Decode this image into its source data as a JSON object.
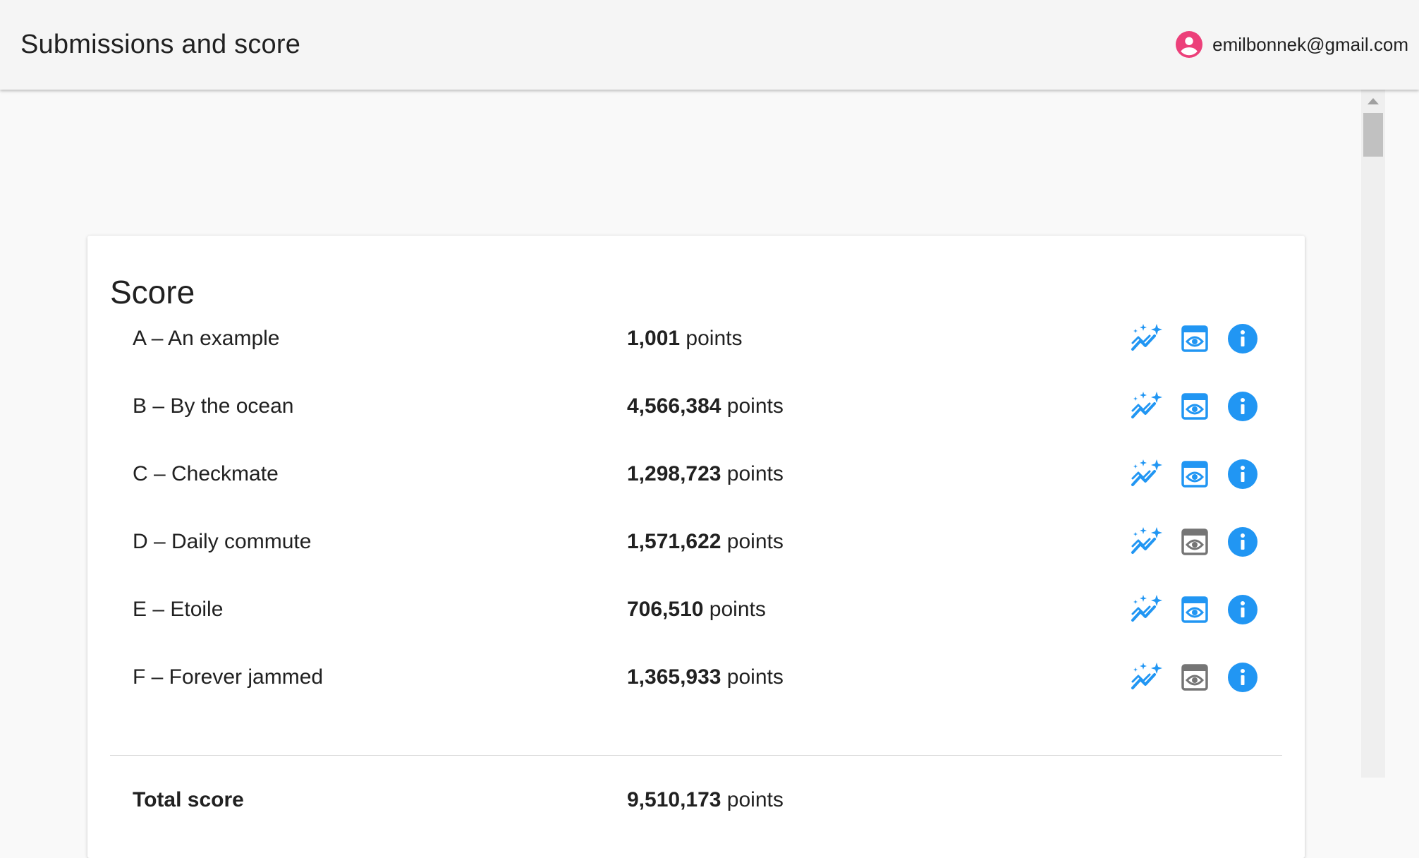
{
  "header": {
    "title": "Submissions and score",
    "user_email": "emilbonnek@gmail.com"
  },
  "card": {
    "title": "Score"
  },
  "rows": [
    {
      "name": "A – An example",
      "score": "1,001",
      "unit": " points",
      "preview_enabled": true
    },
    {
      "name": "B – By the ocean",
      "score": "4,566,384",
      "unit": " points",
      "preview_enabled": true
    },
    {
      "name": "C – Checkmate",
      "score": "1,298,723",
      "unit": " points",
      "preview_enabled": true
    },
    {
      "name": "D – Daily commute",
      "score": "1,571,622",
      "unit": " points",
      "preview_enabled": false
    },
    {
      "name": "E – Etoile",
      "score": "706,510",
      "unit": " points",
      "preview_enabled": true
    },
    {
      "name": "F – Forever jammed",
      "score": "1,365,933",
      "unit": " points",
      "preview_enabled": false
    }
  ],
  "total": {
    "label": "Total score",
    "score": "9,510,173",
    "unit": " points"
  },
  "icons": {
    "avatar": "account-circle-icon",
    "visualize": "auto-graph-icon",
    "preview": "preview-icon",
    "info": "info-icon"
  },
  "colors": {
    "accent": "#2196f3",
    "avatar": "#ec407a",
    "disabled": "#757575"
  }
}
